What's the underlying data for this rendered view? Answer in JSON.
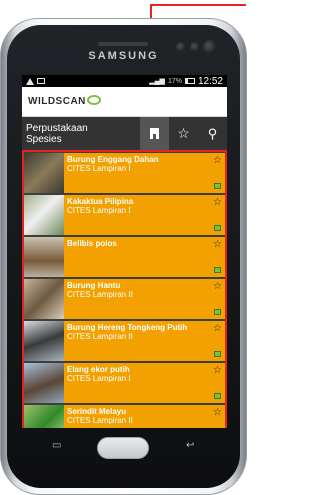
{
  "device": {
    "brand": "SAMSUNG"
  },
  "status_bar": {
    "battery_percent": "17%",
    "time": "12:52"
  },
  "app": {
    "logo_text": "WILDSCAN"
  },
  "toolbar": {
    "title_line1": "Perpustakaan",
    "title_line2": "Spesies",
    "buttons": [
      "library-icon",
      "star-icon",
      "search-icon"
    ]
  },
  "species": [
    {
      "name": "Burung Enggang Dahan",
      "status": "CITES Lampiran I",
      "thumb_color": "#5a5a4e"
    },
    {
      "name": "Kakaktua Pilipina",
      "status": "CITES Lampiran I",
      "thumb_color": "#6f8a5a"
    },
    {
      "name": "Belibis polos",
      "status": "",
      "thumb_color": "#7a6a50"
    },
    {
      "name": "Burung Hantu",
      "status": "CITES Lampiran II",
      "thumb_color": "#8c7b62"
    },
    {
      "name": "Burung Hereng Tongkeng Putih",
      "status": "CITES Lampiran II",
      "thumb_color": "#9aa6b2"
    },
    {
      "name": "Elang ekor putih",
      "status": "CITES Lampiran I",
      "thumb_color": "#8fa6bf"
    },
    {
      "name": "Serindit Melayu",
      "status": "CITES Lampiran II",
      "thumb_color": "#6e8f3c"
    }
  ],
  "colors": {
    "accent": "#f2a100",
    "annotation": "#e8231f",
    "toolbar": "#333333",
    "logo_mark": "#79c142"
  }
}
